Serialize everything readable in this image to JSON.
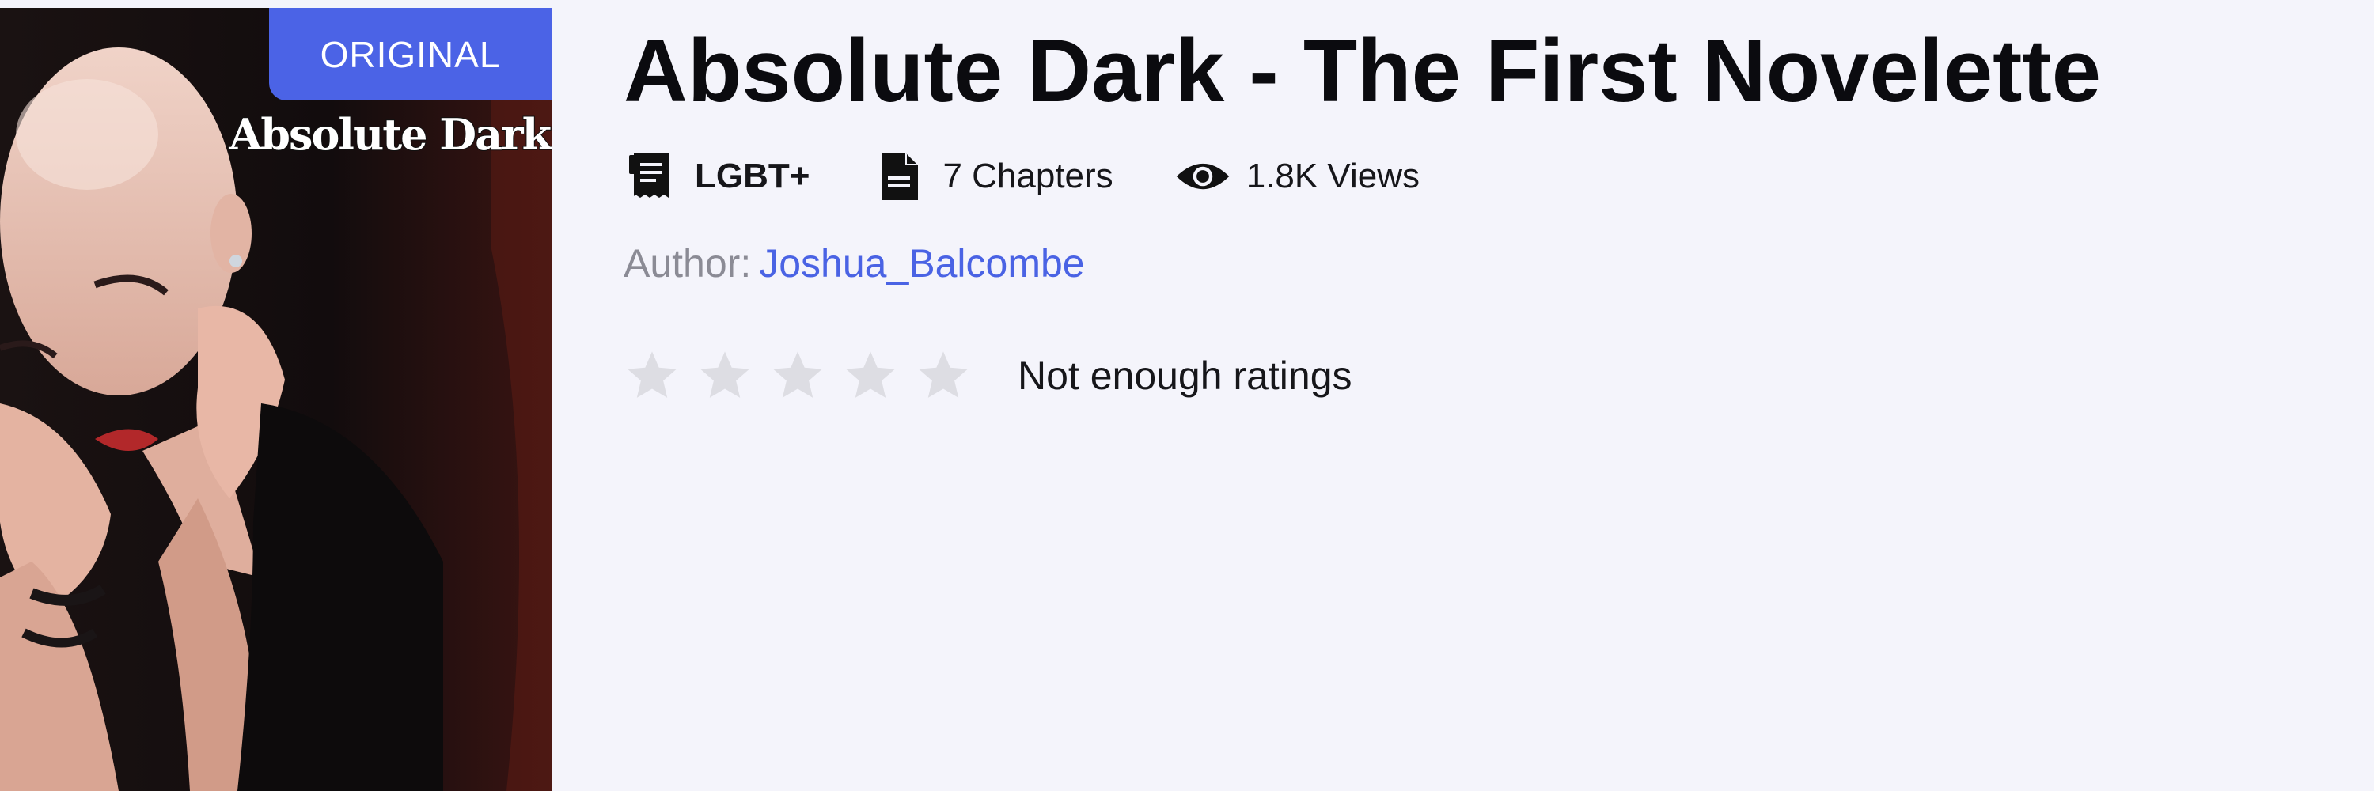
{
  "cover": {
    "badge": "ORIGINAL",
    "title": "Absolute Dark"
  },
  "book": {
    "title": "Absolute Dark - The First Novelette",
    "genre": "LGBT+",
    "chapters": "7 Chapters",
    "views": "1.8K Views",
    "author_label": "Author:",
    "author_name": "Joshua_Balcombe"
  },
  "rating": {
    "value": 0,
    "max": 5,
    "text": "Not enough ratings"
  },
  "colors": {
    "accent": "#4b63e6",
    "link": "#4a63e4",
    "background": "#f4f4fb",
    "star_empty": "#dddde3"
  },
  "icons": {
    "genre": "receipt-icon",
    "chapters": "document-icon",
    "views": "eye-icon",
    "star": "star-icon"
  }
}
